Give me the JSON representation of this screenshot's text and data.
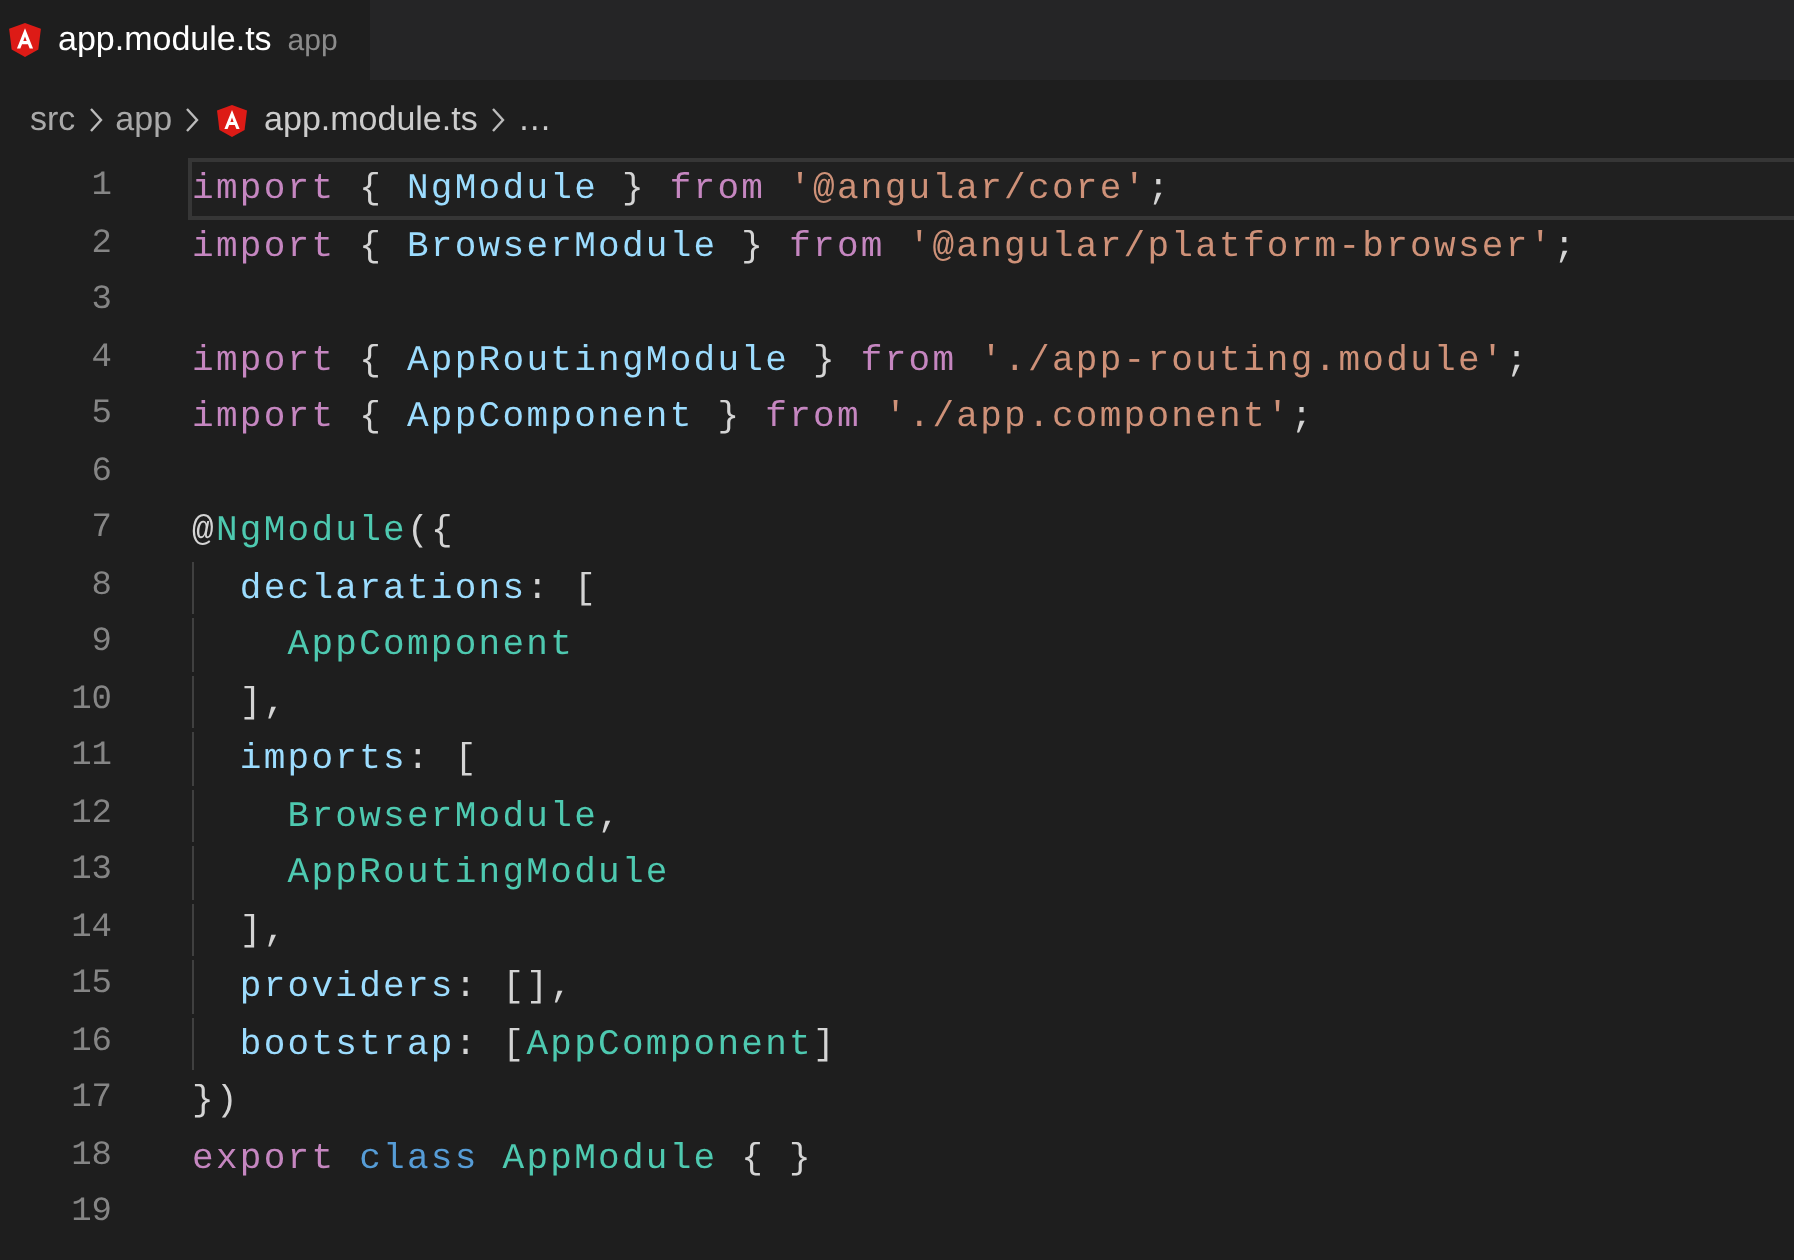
{
  "tab": {
    "title": "app.module.ts",
    "description": "app",
    "selected": true
  },
  "breadcrumb": [
    {
      "label": "src",
      "kind": "folder"
    },
    {
      "label": "app",
      "kind": "folder"
    },
    {
      "label": "app.module.ts",
      "kind": "file"
    },
    {
      "label": "…",
      "kind": "more"
    }
  ],
  "lines": [
    {
      "number": "1",
      "current": true,
      "tokens": [
        {
          "kind": "keyword",
          "text": "import"
        },
        {
          "kind": "punct",
          "text": " { "
        },
        {
          "kind": "variable",
          "text": "NgModule"
        },
        {
          "kind": "punct",
          "text": " } "
        },
        {
          "kind": "keyword",
          "text": "from"
        },
        {
          "kind": "string",
          "text": " '@angular/core'"
        },
        {
          "kind": "punct",
          "text": ";"
        }
      ]
    },
    {
      "number": "2",
      "current": false,
      "tokens": [
        {
          "kind": "keyword",
          "text": "import"
        },
        {
          "kind": "punct",
          "text": " { "
        },
        {
          "kind": "variable",
          "text": "BrowserModule"
        },
        {
          "kind": "punct",
          "text": " } "
        },
        {
          "kind": "keyword",
          "text": "from"
        },
        {
          "kind": "string",
          "text": " '@angular/platform-browser'"
        },
        {
          "kind": "punct",
          "text": ";"
        }
      ]
    },
    {
      "number": "3",
      "current": false
    },
    {
      "number": "4",
      "current": false,
      "tokens": [
        {
          "kind": "keyword",
          "text": "import"
        },
        {
          "kind": "punct",
          "text": " { "
        },
        {
          "kind": "variable",
          "text": "AppRoutingModule"
        },
        {
          "kind": "punct",
          "text": " } "
        },
        {
          "kind": "keyword",
          "text": "from"
        },
        {
          "kind": "string",
          "text": " './app-routing.module'"
        },
        {
          "kind": "punct",
          "text": ";"
        }
      ]
    },
    {
      "number": "5",
      "current": false,
      "tokens": [
        {
          "kind": "keyword",
          "text": "import"
        },
        {
          "kind": "punct",
          "text": " { "
        },
        {
          "kind": "variable",
          "text": "AppComponent"
        },
        {
          "kind": "punct",
          "text": " } "
        },
        {
          "kind": "keyword",
          "text": "from"
        },
        {
          "kind": "string",
          "text": " './app.component'"
        },
        {
          "kind": "punct",
          "text": ";"
        }
      ]
    },
    {
      "number": "6",
      "current": false
    },
    {
      "number": "7",
      "current": false,
      "tokens": [
        {
          "kind": "punct",
          "text": "@"
        },
        {
          "kind": "type",
          "text": "NgModule"
        },
        {
          "kind": "punct",
          "text": "({"
        }
      ]
    },
    {
      "number": "8",
      "current": false,
      "tokens": [
        {
          "kind": "variable",
          "text": "  declarations"
        },
        {
          "kind": "punct",
          "text": ": ["
        }
      ]
    },
    {
      "number": "9",
      "current": false,
      "tokens": [
        {
          "kind": "type",
          "text": "    AppComponent"
        }
      ]
    },
    {
      "number": "10",
      "current": false,
      "tokens": [
        {
          "kind": "punct",
          "text": "  ],"
        }
      ]
    },
    {
      "number": "11",
      "current": false,
      "tokens": [
        {
          "kind": "variable",
          "text": "  imports"
        },
        {
          "kind": "punct",
          "text": ": ["
        }
      ]
    },
    {
      "number": "12",
      "current": false,
      "tokens": [
        {
          "kind": "type",
          "text": "    BrowserModule"
        },
        {
          "kind": "punct",
          "text": ","
        }
      ]
    },
    {
      "number": "13",
      "current": false,
      "tokens": [
        {
          "kind": "type",
          "text": "    AppRoutingModule"
        }
      ]
    },
    {
      "number": "14",
      "current": false,
      "tokens": [
        {
          "kind": "punct",
          "text": "  ],"
        }
      ]
    },
    {
      "number": "15",
      "current": false,
      "tokens": [
        {
          "kind": "variable",
          "text": "  providers"
        },
        {
          "kind": "punct",
          "text": ": [],"
        }
      ]
    },
    {
      "number": "16",
      "current": false,
      "tokens": [
        {
          "kind": "variable",
          "text": "  bootstrap"
        },
        {
          "kind": "punct",
          "text": ": ["
        },
        {
          "kind": "type",
          "text": "AppComponent"
        },
        {
          "kind": "punct",
          "text": "]"
        }
      ]
    },
    {
      "number": "17",
      "current": false,
      "tokens": [
        {
          "kind": "punct",
          "text": "})"
        }
      ]
    },
    {
      "number": "18",
      "current": false,
      "tokens": [
        {
          "kind": "keyword",
          "text": "export"
        },
        {
          "kind": "storage",
          "text": " class"
        },
        {
          "kind": "type",
          "text": " AppModule"
        },
        {
          "kind": "punct",
          "text": " { }"
        }
      ]
    },
    {
      "number": "19",
      "current": false
    }
  ]
}
